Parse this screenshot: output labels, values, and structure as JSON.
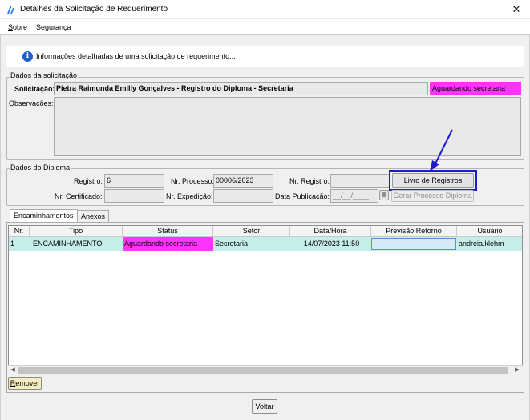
{
  "window": {
    "title": "Detalhes da Solicitação de Requerimento",
    "close_symbol": "✕"
  },
  "menu": {
    "items": [
      {
        "label_first": "S",
        "label_rest": "obre"
      },
      {
        "label": "Segurança"
      }
    ]
  },
  "banner": {
    "text": "Informações detalhadas de uma solicitação de requerimento..."
  },
  "solicitacao": {
    "group_title": "Dados da solicitação",
    "label": "Solicitação:",
    "value": "Pietra Raimunda Emilly Gonçalves - Registro do Diploma - Secretaria",
    "status": "Aguardando secretaria",
    "status_color": "#ff33ff",
    "observacoes_label": "Observações:",
    "observacoes_value": ""
  },
  "diploma": {
    "group_title": "Dados do Diploma",
    "registro_label": "Registro:",
    "registro_value": "6",
    "nr_processo_label": "Nr. Processo:",
    "nr_processo_value": "00006/2023",
    "nr_registro_label": "Nr. Registro:",
    "nr_registro_value": "",
    "nr_certificado_label": "Nr. Certificado:",
    "nr_certificado_value": "",
    "nr_expedicao_label": "Nr. Expedição:",
    "nr_expedicao_value": "",
    "data_publicacao_label": "Data Publicação:",
    "data_publicacao_value": "__/__/____",
    "livro_button": "Livro de Registros",
    "gerar_button": "Gerar Processo Diploma"
  },
  "tabs": [
    {
      "label": "Encaminhamentos"
    },
    {
      "label": "Anexos"
    }
  ],
  "grid": {
    "columns": [
      "Nr.",
      "Tipo",
      "Status",
      "Setor",
      "Data/Hora",
      "Previsão Retorno",
      "Usuário"
    ],
    "rows": [
      {
        "nr": "1",
        "tipo": "ENCAMINHAMENTO",
        "status": "Aguardando secretaria",
        "setor": "Secretaria",
        "data_hora": "14/07/2023 11:50",
        "previsao": "",
        "usuario": "andreia.klehm"
      }
    ]
  },
  "buttons": {
    "remover_first": "R",
    "remover_rest": "emover",
    "voltar_first": "V",
    "voltar_rest": "oltar"
  },
  "colors": {
    "accent_highlight": "#1c1ccc",
    "row_selected": "#c7ede9",
    "status_pink": "#ff33ff"
  }
}
